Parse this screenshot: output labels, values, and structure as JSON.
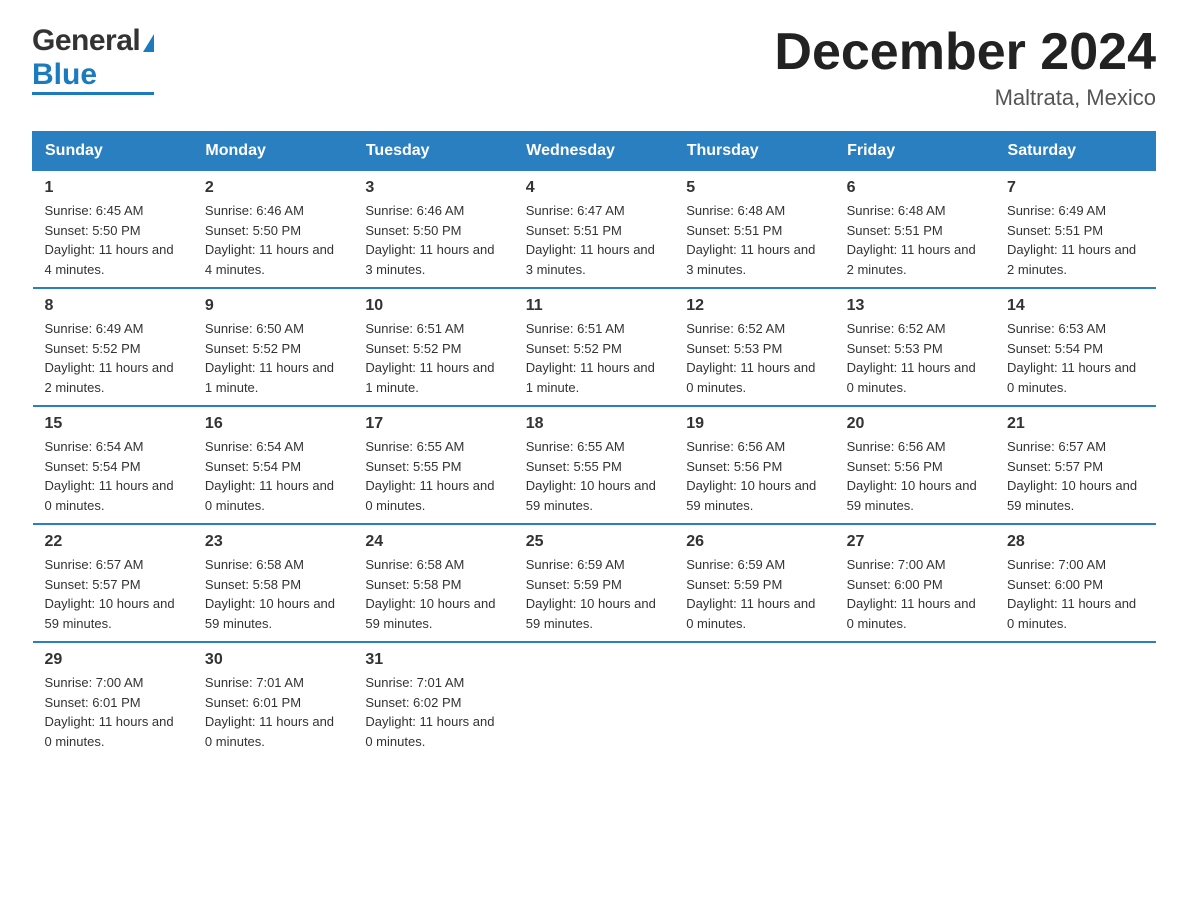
{
  "header": {
    "logo_general": "General",
    "logo_blue": "Blue",
    "month": "December 2024",
    "location": "Maltrata, Mexico"
  },
  "days_of_week": [
    "Sunday",
    "Monday",
    "Tuesday",
    "Wednesday",
    "Thursday",
    "Friday",
    "Saturday"
  ],
  "weeks": [
    [
      {
        "day": "1",
        "sunrise": "6:45 AM",
        "sunset": "5:50 PM",
        "daylight": "11 hours and 4 minutes."
      },
      {
        "day": "2",
        "sunrise": "6:46 AM",
        "sunset": "5:50 PM",
        "daylight": "11 hours and 4 minutes."
      },
      {
        "day": "3",
        "sunrise": "6:46 AM",
        "sunset": "5:50 PM",
        "daylight": "11 hours and 3 minutes."
      },
      {
        "day": "4",
        "sunrise": "6:47 AM",
        "sunset": "5:51 PM",
        "daylight": "11 hours and 3 minutes."
      },
      {
        "day": "5",
        "sunrise": "6:48 AM",
        "sunset": "5:51 PM",
        "daylight": "11 hours and 3 minutes."
      },
      {
        "day": "6",
        "sunrise": "6:48 AM",
        "sunset": "5:51 PM",
        "daylight": "11 hours and 2 minutes."
      },
      {
        "day": "7",
        "sunrise": "6:49 AM",
        "sunset": "5:51 PM",
        "daylight": "11 hours and 2 minutes."
      }
    ],
    [
      {
        "day": "8",
        "sunrise": "6:49 AM",
        "sunset": "5:52 PM",
        "daylight": "11 hours and 2 minutes."
      },
      {
        "day": "9",
        "sunrise": "6:50 AM",
        "sunset": "5:52 PM",
        "daylight": "11 hours and 1 minute."
      },
      {
        "day": "10",
        "sunrise": "6:51 AM",
        "sunset": "5:52 PM",
        "daylight": "11 hours and 1 minute."
      },
      {
        "day": "11",
        "sunrise": "6:51 AM",
        "sunset": "5:52 PM",
        "daylight": "11 hours and 1 minute."
      },
      {
        "day": "12",
        "sunrise": "6:52 AM",
        "sunset": "5:53 PM",
        "daylight": "11 hours and 0 minutes."
      },
      {
        "day": "13",
        "sunrise": "6:52 AM",
        "sunset": "5:53 PM",
        "daylight": "11 hours and 0 minutes."
      },
      {
        "day": "14",
        "sunrise": "6:53 AM",
        "sunset": "5:54 PM",
        "daylight": "11 hours and 0 minutes."
      }
    ],
    [
      {
        "day": "15",
        "sunrise": "6:54 AM",
        "sunset": "5:54 PM",
        "daylight": "11 hours and 0 minutes."
      },
      {
        "day": "16",
        "sunrise": "6:54 AM",
        "sunset": "5:54 PM",
        "daylight": "11 hours and 0 minutes."
      },
      {
        "day": "17",
        "sunrise": "6:55 AM",
        "sunset": "5:55 PM",
        "daylight": "11 hours and 0 minutes."
      },
      {
        "day": "18",
        "sunrise": "6:55 AM",
        "sunset": "5:55 PM",
        "daylight": "10 hours and 59 minutes."
      },
      {
        "day": "19",
        "sunrise": "6:56 AM",
        "sunset": "5:56 PM",
        "daylight": "10 hours and 59 minutes."
      },
      {
        "day": "20",
        "sunrise": "6:56 AM",
        "sunset": "5:56 PM",
        "daylight": "10 hours and 59 minutes."
      },
      {
        "day": "21",
        "sunrise": "6:57 AM",
        "sunset": "5:57 PM",
        "daylight": "10 hours and 59 minutes."
      }
    ],
    [
      {
        "day": "22",
        "sunrise": "6:57 AM",
        "sunset": "5:57 PM",
        "daylight": "10 hours and 59 minutes."
      },
      {
        "day": "23",
        "sunrise": "6:58 AM",
        "sunset": "5:58 PM",
        "daylight": "10 hours and 59 minutes."
      },
      {
        "day": "24",
        "sunrise": "6:58 AM",
        "sunset": "5:58 PM",
        "daylight": "10 hours and 59 minutes."
      },
      {
        "day": "25",
        "sunrise": "6:59 AM",
        "sunset": "5:59 PM",
        "daylight": "10 hours and 59 minutes."
      },
      {
        "day": "26",
        "sunrise": "6:59 AM",
        "sunset": "5:59 PM",
        "daylight": "11 hours and 0 minutes."
      },
      {
        "day": "27",
        "sunrise": "7:00 AM",
        "sunset": "6:00 PM",
        "daylight": "11 hours and 0 minutes."
      },
      {
        "day": "28",
        "sunrise": "7:00 AM",
        "sunset": "6:00 PM",
        "daylight": "11 hours and 0 minutes."
      }
    ],
    [
      {
        "day": "29",
        "sunrise": "7:00 AM",
        "sunset": "6:01 PM",
        "daylight": "11 hours and 0 minutes."
      },
      {
        "day": "30",
        "sunrise": "7:01 AM",
        "sunset": "6:01 PM",
        "daylight": "11 hours and 0 minutes."
      },
      {
        "day": "31",
        "sunrise": "7:01 AM",
        "sunset": "6:02 PM",
        "daylight": "11 hours and 0 minutes."
      },
      null,
      null,
      null,
      null
    ]
  ]
}
